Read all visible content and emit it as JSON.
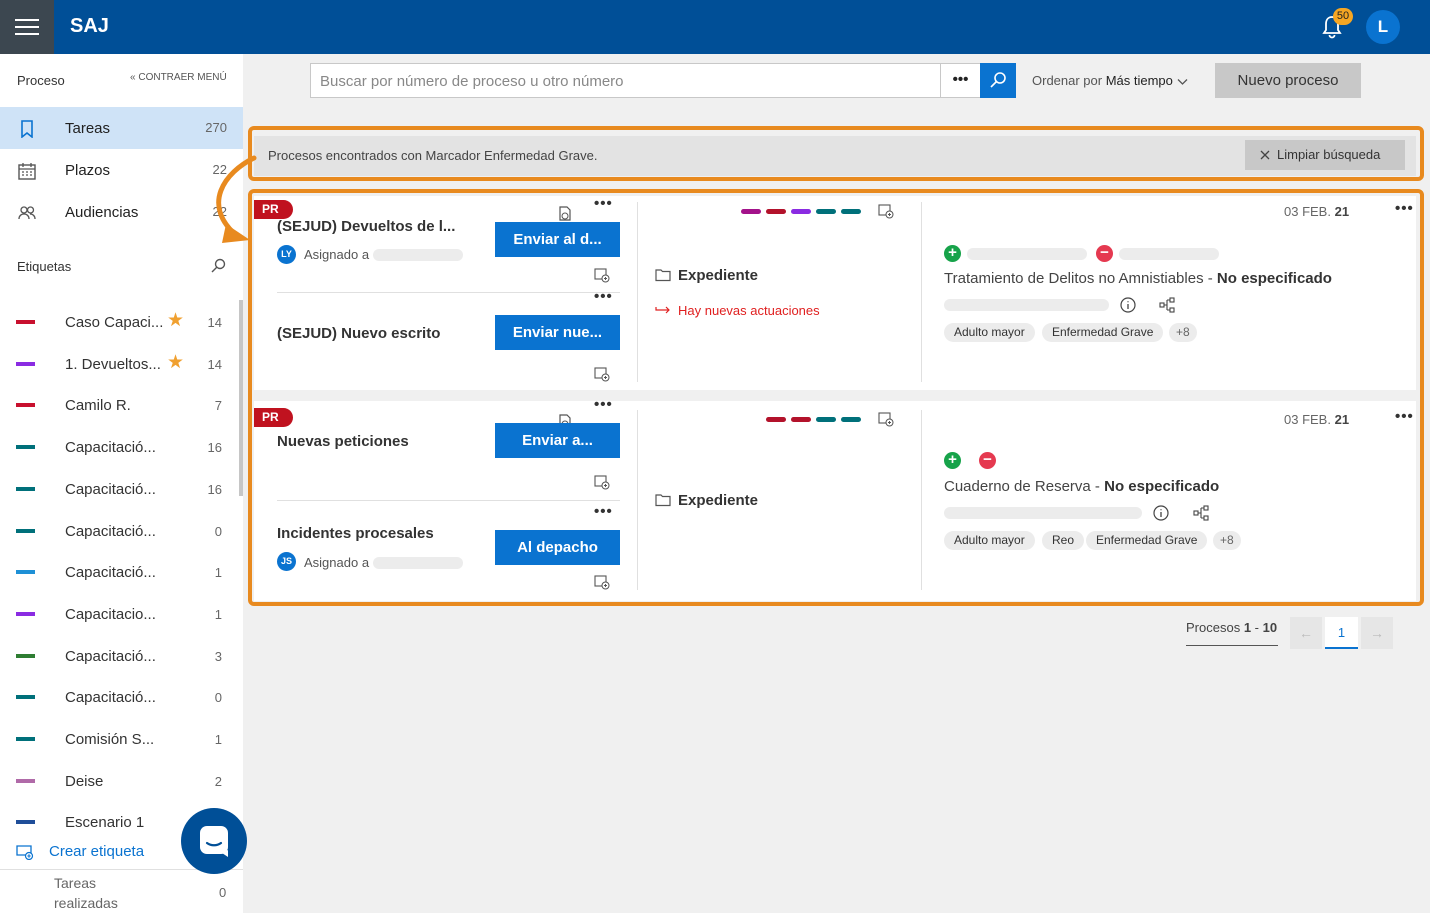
{
  "header": {
    "app_name": "SAJ",
    "notifications_count": "50",
    "user_initial": "L"
  },
  "sidebar": {
    "section_title": "Proceso",
    "collapse_label": "CONTRAER MENÚ",
    "nav": [
      {
        "label": "Tareas",
        "count": "270",
        "icon": "bookmark-icon"
      },
      {
        "label": "Plazos",
        "count": "22",
        "icon": "calendar-icon"
      },
      {
        "label": "Audiencias",
        "count": "22",
        "icon": "people-icon"
      }
    ],
    "tags_title": "Etiquetas",
    "tags": [
      {
        "label": "Caso Capaci...",
        "count": "14",
        "color": "#c8102e",
        "starred": true
      },
      {
        "label": "1. Devueltos...",
        "count": "14",
        "color": "#8a2be2",
        "starred": true
      },
      {
        "label": "Camilo R.",
        "count": "7",
        "color": "#c8102e",
        "starred": false
      },
      {
        "label": "Capacitació...",
        "count": "16",
        "color": "#00707a",
        "starred": false
      },
      {
        "label": "Capacitació...",
        "count": "16",
        "color": "#00707a",
        "starred": false
      },
      {
        "label": "Capacitació...",
        "count": "0",
        "color": "#00707a",
        "starred": false
      },
      {
        "label": "Capacitació...",
        "count": "1",
        "color": "#1e90d6",
        "starred": false
      },
      {
        "label": "Capacitacio...",
        "count": "1",
        "color": "#8a2be2",
        "starred": false
      },
      {
        "label": "Capacitació...",
        "count": "3",
        "color": "#2e7d32",
        "starred": false
      },
      {
        "label": "Capacitació...",
        "count": "0",
        "color": "#00707a",
        "starred": false
      },
      {
        "label": "Comisión S...",
        "count": "1",
        "color": "#00707a",
        "starred": false
      },
      {
        "label": "Deise",
        "count": "2",
        "color": "#b06aa8",
        "starred": false
      },
      {
        "label": "Escenario 1",
        "count": "",
        "color": "#1f4e99",
        "starred": false
      }
    ],
    "create_tag_label": "Crear etiqueta",
    "done_label_1": "Tareas",
    "done_label_2": "realizadas",
    "done_count": "0",
    "star_glyph": "★"
  },
  "toolbar": {
    "search_placeholder": "Buscar por número de proceso u otro número",
    "more_label": "•••",
    "order_prefix": "Ordenar por ",
    "order_value": "Más tiempo",
    "new_process_label": "Nuevo proceso"
  },
  "banner": {
    "text": "Procesos encontrados con Marcador Enfermedad Grave.",
    "clear_label": "Limpiar búsqueda"
  },
  "processes": [
    {
      "badge": "PR",
      "tasks": [
        {
          "title": "(SEJUD) Devueltos de l...",
          "assigned_prefix": "Asignado a",
          "initials": "LY",
          "action": "Enviar al d...",
          "more": "•••"
        },
        {
          "title": "(SEJUD) Nuevo escrito",
          "action": "Enviar nue...",
          "more": "•••"
        }
      ],
      "expediente_label": "Expediente",
      "new_actions_label": "Hay nuevas actuaciones",
      "colors": [
        "#a3128a",
        "#b3122b",
        "#8a2be2",
        "#00707a",
        "#00707a"
      ],
      "date_prefix": "03 FEB.",
      "date_year": "21",
      "subject": "Tratamiento de Delitos no Amnistiables",
      "subject_sep": " - ",
      "subject_status": "No especificado",
      "tags": [
        "Adulto mayor",
        "Enfermedad Grave"
      ],
      "more_tags": "+8",
      "more": "•••"
    },
    {
      "badge": "PR",
      "tasks": [
        {
          "title": "Nuevas peticiones",
          "action": "Enviar a...",
          "more": "•••"
        },
        {
          "title": "Incidentes procesales",
          "assigned_prefix": "Asignado a",
          "initials": "JS",
          "action": "Al depacho",
          "more": "•••"
        }
      ],
      "expediente_label": "Expediente",
      "colors": [
        "#b3122b",
        "#b3122b",
        "#00707a",
        "#00707a"
      ],
      "date_prefix": "03 FEB.",
      "date_year": "21",
      "subject": "Cuaderno de Reserva",
      "subject_sep": " - ",
      "subject_status": "No especificado",
      "tags": [
        "Adulto mayor",
        "Reo",
        "Enfermedad Grave"
      ],
      "more_tags": "+8",
      "more": "•••"
    }
  ],
  "pagination": {
    "prefix": "Procesos",
    "range_start": "1",
    "range_sep": " - ",
    "range_end": "10",
    "current_page": "1",
    "prev": "←",
    "next": "→"
  },
  "colors": {
    "primary": "#0a73d0",
    "header": "#004f97",
    "highlight": "#e88a1f"
  }
}
